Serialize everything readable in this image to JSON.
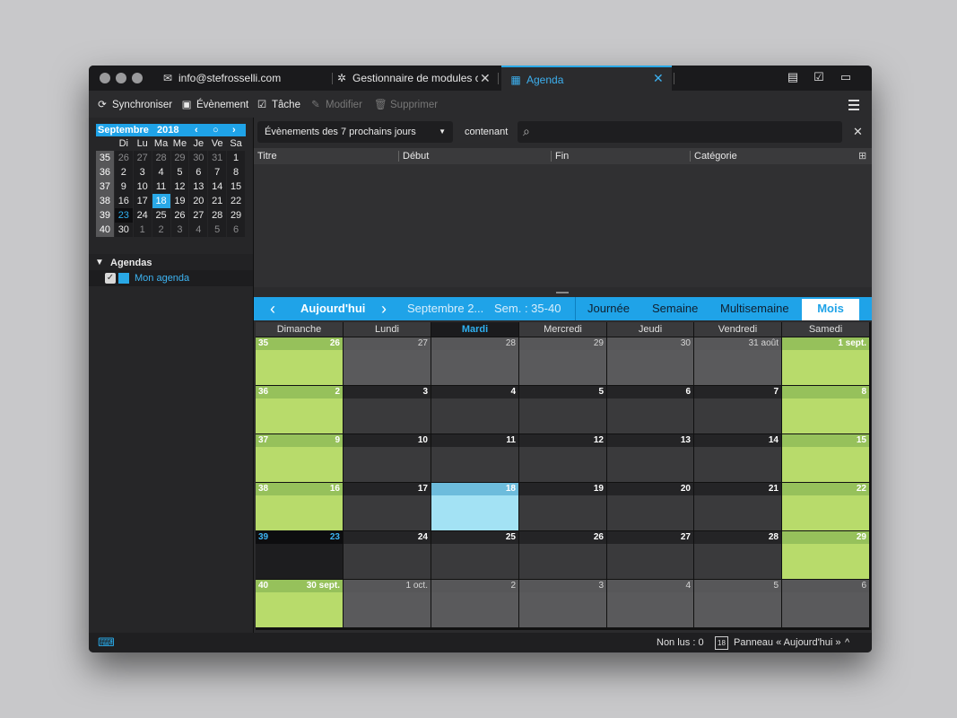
{
  "tabs": [
    {
      "label": "info@stefrosselli.com",
      "icon": "mail-icon"
    },
    {
      "label": "Gestionnaire de modules co",
      "icon": "puzzle-icon"
    },
    {
      "label": "Agenda",
      "icon": "calendar-icon",
      "close": "✕"
    }
  ],
  "tab_close": "✕",
  "toolbar": {
    "sync": "Synchroniser",
    "event": "Évènement",
    "task": "Tâche",
    "edit": "Modifier",
    "delete": "Supprimer"
  },
  "minical": {
    "month": "Septembre",
    "year": "2018",
    "prev": "‹",
    "today": "○",
    "next": "›",
    "weekdays": [
      "Di",
      "Lu",
      "Ma",
      "Me",
      "Je",
      "Ve",
      "Sa"
    ],
    "rows": [
      {
        "wk": "35",
        "days": [
          "26",
          "27",
          "28",
          "29",
          "30",
          "31",
          "1"
        ]
      },
      {
        "wk": "36",
        "days": [
          "2",
          "3",
          "4",
          "5",
          "6",
          "7",
          "8"
        ]
      },
      {
        "wk": "37",
        "days": [
          "9",
          "10",
          "11",
          "12",
          "13",
          "14",
          "15"
        ]
      },
      {
        "wk": "38",
        "days": [
          "16",
          "17",
          "18",
          "19",
          "20",
          "21",
          "22"
        ]
      },
      {
        "wk": "39",
        "days": [
          "23",
          "24",
          "25",
          "26",
          "27",
          "28",
          "29"
        ]
      },
      {
        "wk": "40",
        "days": [
          "30",
          "1",
          "2",
          "3",
          "4",
          "5",
          "6"
        ]
      }
    ]
  },
  "agendas": {
    "title": "Agendas",
    "item": "Mon agenda",
    "item_color": "#29a8e6"
  },
  "filter": {
    "selected": "Évènements des 7 prochains jours",
    "containing": "contenant",
    "clear": "✕"
  },
  "list_columns": [
    "Titre",
    "Début",
    "Fin",
    "Catégorie"
  ],
  "nav": {
    "prev": "‹",
    "today": "Aujourd'hui",
    "next": "›",
    "month_label": "Septembre 2...",
    "week_label": "Sem. : 35-40",
    "views": [
      "Journée",
      "Semaine",
      "Multisemaine",
      "Mois"
    ],
    "active_view": "Mois"
  },
  "month_view": {
    "days": [
      "Dimanche",
      "Lundi",
      "Mardi",
      "Mercredi",
      "Jeudi",
      "Vendredi",
      "Samedi"
    ],
    "highlight_day": "Mardi",
    "weeks": [
      {
        "wk": "35",
        "days": [
          "26",
          "27",
          "28",
          "29",
          "30",
          "31 août",
          "1 sept."
        ]
      },
      {
        "wk": "36",
        "days": [
          "2",
          "3",
          "4",
          "5",
          "6",
          "7",
          "8"
        ]
      },
      {
        "wk": "37",
        "days": [
          "9",
          "10",
          "11",
          "12",
          "13",
          "14",
          "15"
        ]
      },
      {
        "wk": "38",
        "days": [
          "16",
          "17",
          "18",
          "19",
          "20",
          "21",
          "22"
        ]
      },
      {
        "wk": "39",
        "days": [
          "23",
          "24",
          "25",
          "26",
          "27",
          "28",
          "29"
        ]
      },
      {
        "wk": "40",
        "days": [
          "30 sept.",
          "1 oct.",
          "2",
          "3",
          "4",
          "5",
          "6"
        ]
      }
    ]
  },
  "status": {
    "unread": "Non lus : 0",
    "panel": "Panneau « Aujourd'hui »",
    "panel_icon_day": "18",
    "chevron": "^"
  },
  "colors": {
    "accent": "#1fa3e8",
    "weekend": "#b8db6b",
    "today": "#a3e2f4"
  }
}
